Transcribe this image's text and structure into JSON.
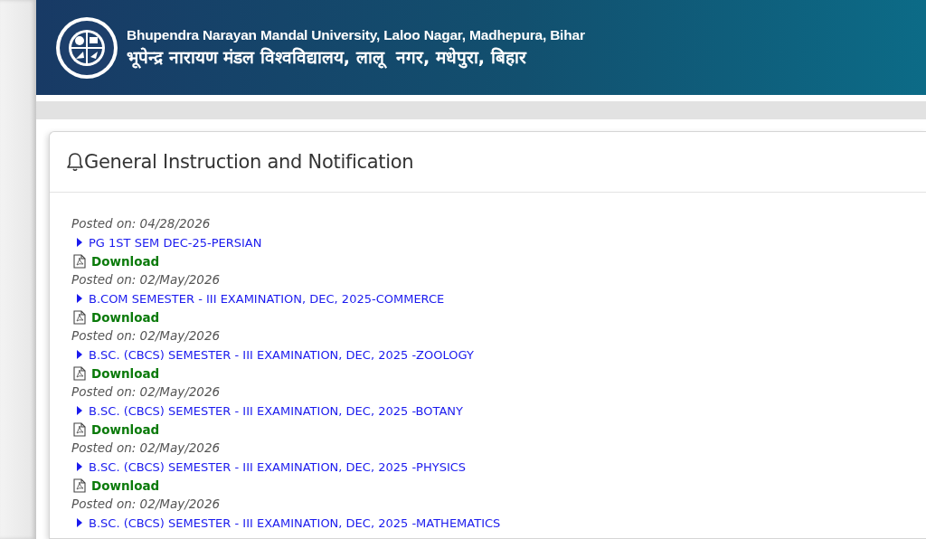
{
  "header": {
    "title_en": "Bhupendra Narayan Mandal University, Laloo Nagar, Madhepura, Bihar",
    "title_hi": "भूपेन्द्र नारायण मंडल विश्वविद्यालय, लालू  नगर, मधेपुरा, बिहार"
  },
  "panel": {
    "title": "General Instruction and Notification"
  },
  "notices": [
    {
      "posted": "Posted on: 04/28/2026",
      "title": "PG 1ST SEM DEC-25-PERSIAN",
      "download": "Download"
    },
    {
      "posted": "Posted on: 02/May/2026",
      "title": "B.COM SEMESTER - III EXAMINATION, DEC, 2025-COMMERCE",
      "download": "Download"
    },
    {
      "posted": "Posted on: 02/May/2026",
      "title": "B.SC. (CBCS) SEMESTER - III EXAMINATION, DEC, 2025 -ZOOLOGY",
      "download": "Download"
    },
    {
      "posted": "Posted on: 02/May/2026",
      "title": "B.SC. (CBCS) SEMESTER - III EXAMINATION, DEC, 2025 -BOTANY",
      "download": "Download"
    },
    {
      "posted": "Posted on: 02/May/2026",
      "title": "B.SC. (CBCS) SEMESTER - III EXAMINATION, DEC, 2025 -PHYSICS",
      "download": "Download"
    },
    {
      "posted": "Posted on: 02/May/2026",
      "title": "B.SC. (CBCS) SEMESTER - III EXAMINATION, DEC, 2025 -MATHEMATICS"
    }
  ]
}
